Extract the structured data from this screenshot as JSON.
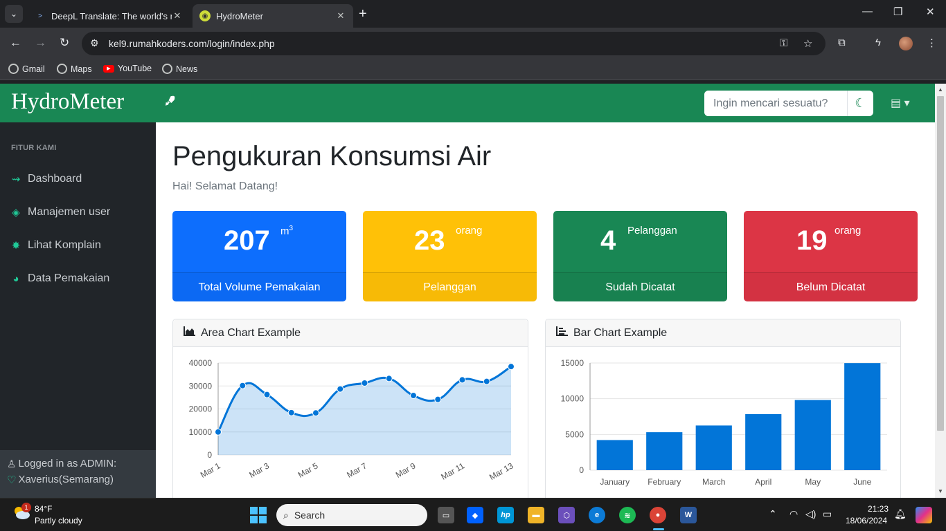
{
  "browser": {
    "tabs": [
      {
        "title": "DeepL Translate: The world's most accurate translator",
        "active": false
      },
      {
        "title": "HydroMeter",
        "active": true
      }
    ],
    "url": "kel9.rumahkoders.com/login/index.php",
    "bookmarks": [
      "Gmail",
      "Maps",
      "YouTube",
      "News"
    ]
  },
  "app": {
    "brand": "HydroMeter",
    "search_placeholder": "Ingin mencari sesuatu?"
  },
  "sidebar": {
    "heading": "FITUR KAMI",
    "items": [
      {
        "label": "Dashboard",
        "icon": "dashboard-icon"
      },
      {
        "label": "Manajemen user",
        "icon": "tag-icon"
      },
      {
        "label": "Lihat Komplain",
        "icon": "star-icon"
      },
      {
        "label": "Data Pemakaian",
        "icon": "chart-icon"
      }
    ],
    "footer": {
      "logged_in": "Logged in as ADMIN:",
      "user": "Xaverius(Semarang)"
    }
  },
  "main": {
    "title": "Pengukuran Konsumsi Air",
    "subtitle": "Hai! Selamat Datang!",
    "cards": [
      {
        "value": "207",
        "unit": "m",
        "unit_sup": "3",
        "label": "Total Volume Pemakaian",
        "color": "#0d6efd"
      },
      {
        "value": "23",
        "unit": "orang",
        "label": "Pelanggan",
        "color": "#ffc107"
      },
      {
        "value": "4",
        "unit": "Pelanggan",
        "label": "Sudah Dicatat",
        "color": "#198754"
      },
      {
        "value": "19",
        "unit": "orang",
        "label": "Belum Dicatat",
        "color": "#dc3545"
      }
    ],
    "area_panel_title": "Area Chart Example",
    "bar_panel_title": "Bar Chart Example"
  },
  "chart_data": [
    {
      "type": "area",
      "title": "Area Chart Example",
      "x": [
        "Mar 1",
        "Mar 2",
        "Mar 3",
        "Mar 4",
        "Mar 5",
        "Mar 6",
        "Mar 7",
        "Mar 8",
        "Mar 9",
        "Mar 10",
        "Mar 11",
        "Mar 12",
        "Mar 13"
      ],
      "x_tick_labels": [
        "Mar 1",
        "Mar 3",
        "Mar 5",
        "Mar 7",
        "Mar 9",
        "Mar 11",
        "Mar 13"
      ],
      "values": [
        10000,
        30162,
        26263,
        18394,
        18287,
        28682,
        31274,
        33259,
        25849,
        24159,
        32651,
        31984,
        38451
      ],
      "ylim": [
        0,
        40000
      ],
      "y_ticks": [
        0,
        10000,
        20000,
        30000,
        40000
      ],
      "color": "#0275d8",
      "grid": true
    },
    {
      "type": "bar",
      "title": "Bar Chart Example",
      "categories": [
        "January",
        "February",
        "March",
        "April",
        "May",
        "June"
      ],
      "values": [
        4215,
        5312,
        6251,
        7841,
        9821,
        14984
      ],
      "ylim": [
        0,
        15000
      ],
      "y_ticks": [
        0,
        5000,
        10000,
        15000
      ],
      "color": "#0275d8",
      "grid": true
    }
  ],
  "taskbar": {
    "weather_temp": "84°F",
    "weather_desc": "Partly cloudy",
    "weather_badge": "1",
    "search_label": "Search",
    "time": "21:23",
    "date": "18/06/2024"
  }
}
